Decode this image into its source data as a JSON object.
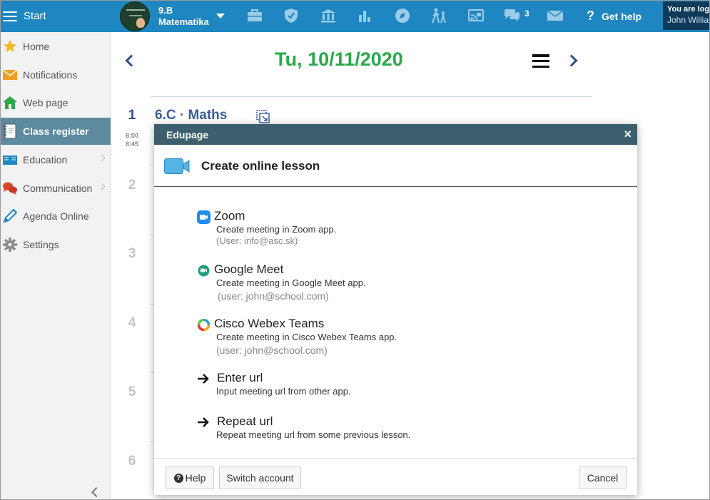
{
  "topbar": {
    "start_label": "Start",
    "class_code": "9.B",
    "class_subject": "Matematika",
    "icons": [
      "briefcase-icon",
      "shield-icon",
      "institution-icon",
      "bar-chart-icon",
      "compass-icon",
      "walking-kids-icon",
      "cast-icon",
      "chat-icon",
      "mail-icon"
    ],
    "chat_count": "3",
    "help_label": "Get help",
    "login_line1": "You are logged in as",
    "login_line2": "John Williams"
  },
  "sidebar": {
    "items": [
      {
        "label": "Home",
        "icon": "star-icon",
        "color": "#f2b820"
      },
      {
        "label": "Notifications",
        "icon": "envelope-icon",
        "color": "#f0a020"
      },
      {
        "label": "Web page",
        "icon": "house-icon",
        "color": "#2aa84a"
      },
      {
        "label": "Class register",
        "icon": "notebook-icon",
        "color": "#ffffff"
      },
      {
        "label": "Education",
        "icon": "book-icon",
        "color": "#1e86c0"
      },
      {
        "label": "Communication",
        "icon": "speech-bubbles-icon",
        "color": "#d9472b"
      },
      {
        "label": "Agenda Online",
        "icon": "pen-icon",
        "color": "#1e86c0"
      },
      {
        "label": "Settings",
        "icon": "gear-icon",
        "color": "#8a8a8a"
      }
    ]
  },
  "main": {
    "date": "Tu, 10/11/2020",
    "lesson_numbers": [
      "1",
      "2",
      "3",
      "4",
      "5",
      "6"
    ],
    "lesson1_time_start": "8:00",
    "lesson1_time_end": "8:45",
    "lesson1_title": "6.C · Maths"
  },
  "modal": {
    "header": "Edupage",
    "close": "×",
    "title": "Create online lesson",
    "options": [
      {
        "name": "Zoom",
        "desc": "Create meeting in Zoom app.",
        "user": "(User: info@asc.sk)",
        "icon": "zoom-icon"
      },
      {
        "name": "Google Meet",
        "desc": "Create meeting in Google Meet app.",
        "user": "(user: john@school.com)",
        "icon": "google-meet-icon"
      },
      {
        "name": "Cisco Webex Teams",
        "desc": "Create meeting in Cisco Webex Teams app.",
        "user": "(user: john@school.com)",
        "icon": "webex-icon"
      },
      {
        "name": "Enter url",
        "desc": "Input meeting url from other app.",
        "icon": "arrow-right-icon"
      },
      {
        "name": "Repeat url",
        "desc": "Repeat meeting url from some previous lesson.",
        "icon": "arrow-right-icon"
      }
    ],
    "help_label": "Help",
    "switch_label": "Switch account",
    "cancel_label": "Cancel"
  },
  "colors": {
    "topbar": "#1e86c0",
    "accent_green": "#2aa84a",
    "modal_header": "#3c5f6e",
    "sidebar_active": "#5d8a9f"
  }
}
